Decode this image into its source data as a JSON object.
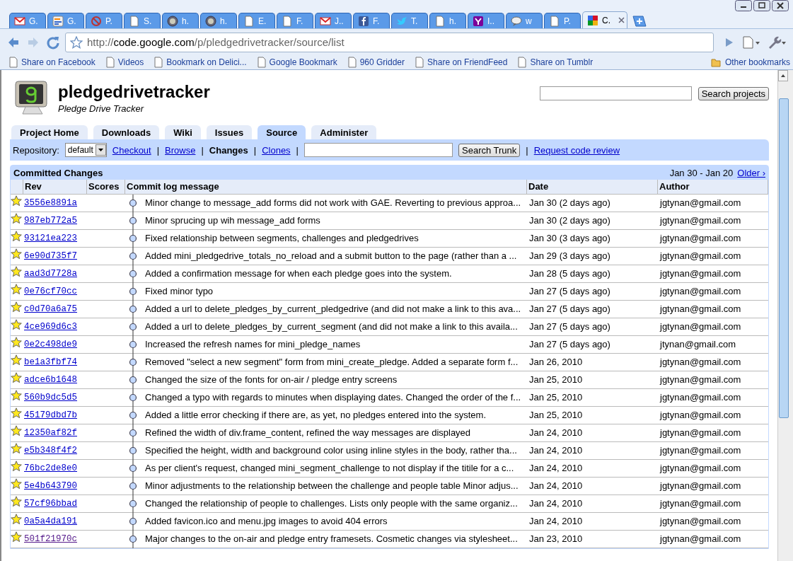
{
  "browser": {
    "tabs": [
      {
        "label": "G.",
        "selected": false
      },
      {
        "label": "G.",
        "selected": false
      },
      {
        "label": "P.",
        "selected": false
      },
      {
        "label": "S.",
        "selected": false
      },
      {
        "label": "h.",
        "selected": false
      },
      {
        "label": "h.",
        "selected": false
      },
      {
        "label": "E.",
        "selected": false
      },
      {
        "label": "F.",
        "selected": false
      },
      {
        "label": "J..",
        "selected": false
      },
      {
        "label": "F.",
        "selected": false
      },
      {
        "label": "T.",
        "selected": false
      },
      {
        "label": "h.",
        "selected": false
      },
      {
        "label": "I..",
        "selected": false
      },
      {
        "label": "w",
        "selected": false
      },
      {
        "label": "P.",
        "selected": false
      },
      {
        "label": "C.",
        "selected": true
      }
    ],
    "address": {
      "scheme": "http://",
      "host": "code.google.com",
      "path": "/p/pledgedrivetracker/source/list"
    },
    "bookmarks": [
      {
        "label": "Share on Facebook",
        "kind": "page"
      },
      {
        "label": "Videos",
        "kind": "page"
      },
      {
        "label": "Bookmark on Delici...",
        "kind": "page"
      },
      {
        "label": "Google Bookmark",
        "kind": "page"
      },
      {
        "label": "960 Gridder",
        "kind": "page"
      },
      {
        "label": "Share on FriendFeed",
        "kind": "page"
      },
      {
        "label": "Share on Tumblr",
        "kind": "page"
      },
      {
        "label": "Other bookmarks",
        "kind": "folder"
      }
    ]
  },
  "project": {
    "name": "pledgedrivetracker",
    "summary": "Pledge Drive Tracker",
    "search_button": "Search projects",
    "tabs": [
      {
        "label": "Project Home",
        "selected": false
      },
      {
        "label": "Downloads",
        "selected": false
      },
      {
        "label": "Wiki",
        "selected": false
      },
      {
        "label": "Issues",
        "selected": false
      },
      {
        "label": "Source",
        "selected": true
      },
      {
        "label": "Administer",
        "selected": false
      }
    ],
    "subnav": {
      "repository_label": "Repository:",
      "repository_value": "default",
      "items": [
        {
          "kind": "link",
          "label": "Checkout"
        },
        {
          "kind": "separator",
          "label": "|"
        },
        {
          "kind": "link",
          "label": "Browse"
        },
        {
          "kind": "separator",
          "label": "|"
        },
        {
          "kind": "current",
          "label": "Changes"
        },
        {
          "kind": "separator",
          "label": "|"
        },
        {
          "kind": "link",
          "label": "Clones"
        },
        {
          "kind": "separator",
          "label": "|"
        },
        {
          "kind": "field"
        },
        {
          "kind": "button",
          "label": "Search Trunk"
        },
        {
          "kind": "separator",
          "label": "|"
        },
        {
          "kind": "link",
          "label": "Request code review"
        }
      ]
    }
  },
  "changes": {
    "title": "Committed Changes",
    "range": "Jan 30 - Jan 20",
    "older": "Older ›",
    "columns": [
      "Rev",
      "Scores",
      "Commit log message",
      "Date",
      "Author"
    ],
    "rows": [
      {
        "rev": "3556e8891a",
        "message": "Minor change to message_add forms did not work with GAE. Reverting to previous approa...",
        "date": "Jan 30 (2 days ago)",
        "author": "jgtynan@gmail.com",
        "visited": false
      },
      {
        "rev": "987eb772a5",
        "message": "Minor sprucing up wih message_add forms",
        "date": "Jan 30 (2 days ago)",
        "author": "jgtynan@gmail.com",
        "visited": false
      },
      {
        "rev": "93121ea223",
        "message": "Fixed relationship between segments, challenges and pledgedrives",
        "date": "Jan 30 (3 days ago)",
        "author": "jgtynan@gmail.com",
        "visited": false
      },
      {
        "rev": "6e90d735f7",
        "message": "Added mini_pledgedrive_totals_no_reload and a submit button to the page (rather than a ...",
        "date": "Jan 29 (3 days ago)",
        "author": "jgtynan@gmail.com",
        "visited": false
      },
      {
        "rev": "aad3d7728a",
        "message": "Added a confirmation message for when each pledge goes into the system.",
        "date": "Jan 28 (5 days ago)",
        "author": "jgtynan@gmail.com",
        "visited": false
      },
      {
        "rev": "0e76cf70cc",
        "message": "Fixed minor typo",
        "date": "Jan 27 (5 days ago)",
        "author": "jgtynan@gmail.com",
        "visited": false
      },
      {
        "rev": "c0d70a6a75",
        "message": "Added a url to delete_pledges_by_current_pledgedrive (and did not make a link to this ava...",
        "date": "Jan 27 (5 days ago)",
        "author": "jgtynan@gmail.com",
        "visited": false
      },
      {
        "rev": "4ce969d6c3",
        "message": "Added a url to delete_pledges_by_current_segment (and did not make a link to this availa...",
        "date": "Jan 27 (5 days ago)",
        "author": "jgtynan@gmail.com",
        "visited": false
      },
      {
        "rev": "0e2c498de9",
        "message": "Increased the refresh names for mini_pledge_names",
        "date": "Jan 27 (5 days ago)",
        "author": "jtynan@gmail.com",
        "visited": false
      },
      {
        "rev": "be1a3fbf74",
        "message": "Removed \"select a new segment\" form from mini_create_pledge. Added a separate form f...",
        "date": "Jan 26, 2010",
        "author": "jgtynan@gmail.com",
        "visited": false
      },
      {
        "rev": "adce6b1648",
        "message": "Changed the size of the fonts for on-air / pledge entry screens",
        "date": "Jan 25, 2010",
        "author": "jgtynan@gmail.com",
        "visited": false
      },
      {
        "rev": "560b9dc5d5",
        "message": "Changed a typo with regards to minutes when displaying dates. Changed the order of the f...",
        "date": "Jan 25, 2010",
        "author": "jgtynan@gmail.com",
        "visited": false
      },
      {
        "rev": "45179dbd7b",
        "message": "Added a little error checking if there are, as yet, no pledges entered into the system.",
        "date": "Jan 25, 2010",
        "author": "jgtynan@gmail.com",
        "visited": false
      },
      {
        "rev": "12350af82f",
        "message": "Refined the width of div.frame_content, refined the way messages are displayed",
        "date": "Jan 24, 2010",
        "author": "jgtynan@gmail.com",
        "visited": false
      },
      {
        "rev": "e5b348f4f2",
        "message": "Specified the height, width and background color using inline styles in the body, rather tha...",
        "date": "Jan 24, 2010",
        "author": "jgtynan@gmail.com",
        "visited": false
      },
      {
        "rev": "76bc2de8e0",
        "message": "As per client's request, changed mini_segment_challenge to not display if the titile for a c...",
        "date": "Jan 24, 2010",
        "author": "jgtynan@gmail.com",
        "visited": false
      },
      {
        "rev": "5e4b643790",
        "message": "Minor adjustments to the relationship between the challenge and people table Minor adjus...",
        "date": "Jan 24, 2010",
        "author": "jgtynan@gmail.com",
        "visited": false
      },
      {
        "rev": "57cf96bbad",
        "message": "Changed the relationship of people to challenges. Lists only people with the same organiz...",
        "date": "Jan 24, 2010",
        "author": "jgtynan@gmail.com",
        "visited": false
      },
      {
        "rev": "0a5a4da191",
        "message": "Added favicon.ico and menu.jpg images to avoid 404 errors",
        "date": "Jan 24, 2010",
        "author": "jgtynan@gmail.com",
        "visited": false
      },
      {
        "rev": "501f21970c",
        "message": "Major changes to the on-air and pledge entry framesets. Cosmetic changes via stylesheet...",
        "date": "Jan 23, 2010",
        "author": "jgtynan@gmail.com",
        "visited": true
      }
    ]
  }
}
